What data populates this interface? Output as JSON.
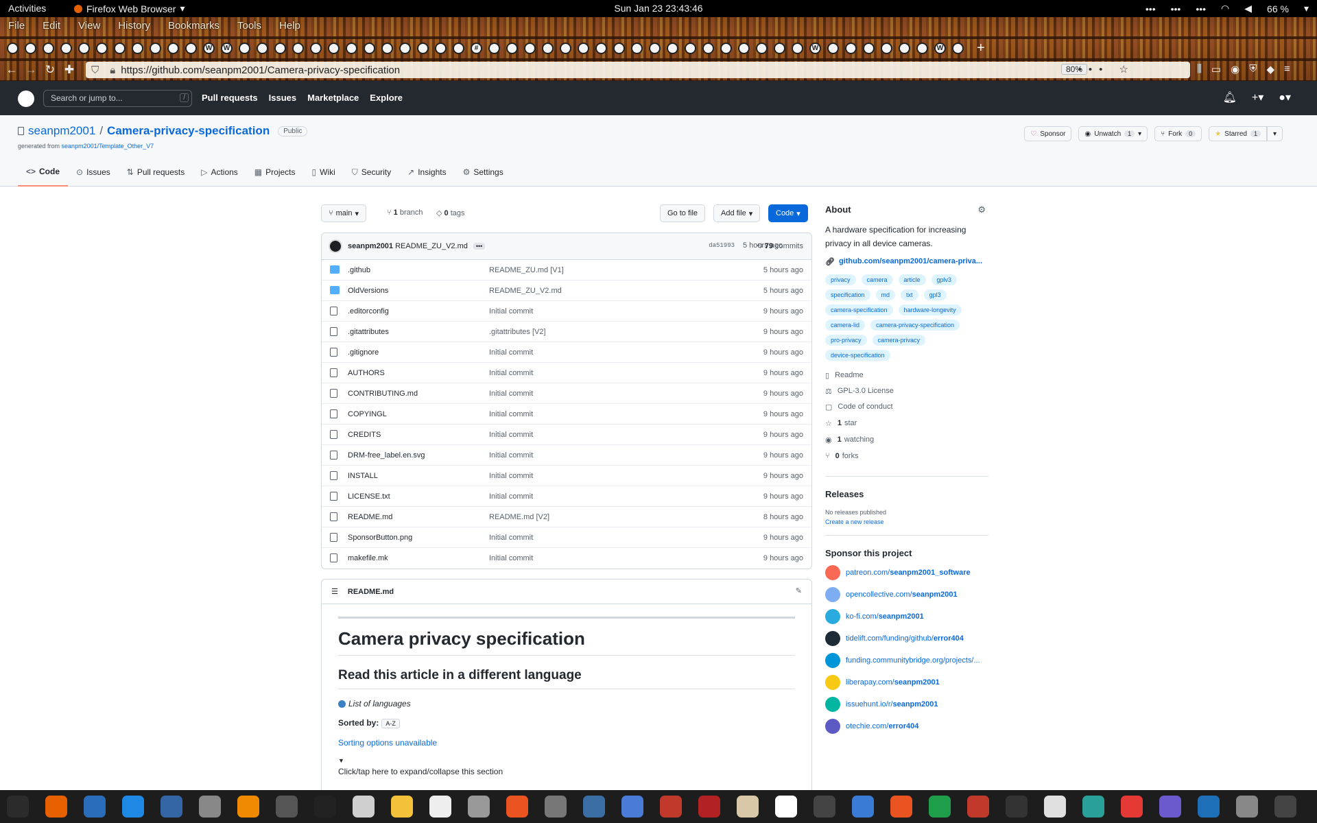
{
  "system": {
    "activities": "Activities",
    "app_name": "Firefox Web Browser",
    "clock": "Sun Jan 23  23:43:46",
    "battery": "66 %"
  },
  "browser": {
    "menu": [
      "File",
      "Edit",
      "View",
      "History",
      "Bookmarks",
      "Tools",
      "Help"
    ],
    "url": "https://github.com/seanpm2001/Camera-privacy-specification",
    "zoom": "80%"
  },
  "github": {
    "search_placeholder": "Search or jump to...",
    "search_shortcut": "/",
    "nav": [
      "Pull requests",
      "Issues",
      "Marketplace",
      "Explore"
    ]
  },
  "repo": {
    "owner": "seanpm2001",
    "sep": "/",
    "name": "Camera-privacy-specification",
    "visibility": "Public",
    "generated_prefix": "generated from ",
    "generated_from": "seanpm2001/Template_Other_V7",
    "actions": {
      "sponsor": "Sponsor",
      "unwatch": "Unwatch",
      "unwatch_count": "1",
      "fork": "Fork",
      "fork_count": "0",
      "starred": "Starred",
      "star_count": "1"
    },
    "tabs": [
      "Code",
      "Issues",
      "Pull requests",
      "Actions",
      "Projects",
      "Wiki",
      "Security",
      "Insights",
      "Settings"
    ]
  },
  "files": {
    "branch": "main",
    "branch_count": "1",
    "branch_label": "branch",
    "tag_count": "0",
    "tag_label": "tags",
    "go_to_file": "Go to file",
    "add_file": "Add file",
    "code": "Code",
    "commit": {
      "author": "seanpm2001",
      "message": "README_ZU_V2.md",
      "hash": "da51993",
      "age": "5 hours ago",
      "count": "79",
      "count_label": "commits"
    },
    "rows": [
      {
        "name": ".github",
        "msg": "README_ZU.md [V1]",
        "age": "5 hours ago",
        "type": "dir"
      },
      {
        "name": "OldVersions",
        "msg": "README_ZU_V2.md",
        "age": "5 hours ago",
        "type": "dir"
      },
      {
        "name": ".editorconfig",
        "msg": "Initial commit",
        "age": "9 hours ago",
        "type": "file"
      },
      {
        "name": ".gitattributes",
        "msg": ".gitattributes [V2]",
        "age": "9 hours ago",
        "type": "file"
      },
      {
        "name": ".gitignore",
        "msg": "Initial commit",
        "age": "9 hours ago",
        "type": "file"
      },
      {
        "name": "AUTHORS",
        "msg": "Initial commit",
        "age": "9 hours ago",
        "type": "file"
      },
      {
        "name": "CONTRIBUTING.md",
        "msg": "Initial commit",
        "age": "9 hours ago",
        "type": "file"
      },
      {
        "name": "COPYINGL",
        "msg": "Initial commit",
        "age": "9 hours ago",
        "type": "file"
      },
      {
        "name": "CREDITS",
        "msg": "Initial commit",
        "age": "9 hours ago",
        "type": "file"
      },
      {
        "name": "DRM-free_label.en.svg",
        "msg": "Initial commit",
        "age": "9 hours ago",
        "type": "file"
      },
      {
        "name": "INSTALL",
        "msg": "Initial commit",
        "age": "9 hours ago",
        "type": "file"
      },
      {
        "name": "LICENSE.txt",
        "msg": "Initial commit",
        "age": "9 hours ago",
        "type": "file"
      },
      {
        "name": "README.md",
        "msg": "README.md [V2]",
        "age": "8 hours ago",
        "type": "file"
      },
      {
        "name": "SponsorButton.png",
        "msg": "Initial commit",
        "age": "9 hours ago",
        "type": "file"
      },
      {
        "name": "makefile.mk",
        "msg": "Initial commit",
        "age": "9 hours ago",
        "type": "file"
      }
    ]
  },
  "readme": {
    "filename": "README.md",
    "h1": "Camera privacy specification",
    "h2": "Read this article in a different language",
    "languages": "List of languages",
    "sorted_by": "Sorted by:",
    "sort_key": "A-Z",
    "sort_link": "Sorting options unavailable",
    "triangle": "▼",
    "click_text": "Click/tap here to expand/collapse this section"
  },
  "about": {
    "title": "About",
    "description": "A hardware specification for increasing privacy in all device cameras.",
    "website": "github.com/seanpm2001/camera-priva...",
    "topics": [
      "privacy",
      "camera",
      "article",
      "gplv3",
      "specification",
      "md",
      "txt",
      "gpl3",
      "camera-specification",
      "hardware-longevity",
      "camera-lid",
      "camera-privacy-specification",
      "pro-privacy",
      "camera-privacy",
      "device-specification"
    ],
    "readme": "Readme",
    "license": "GPL-3.0 License",
    "conduct": "Code of conduct",
    "stars_n": "1",
    "stars": "star",
    "watching_n": "1",
    "watching": "watching",
    "forks_n": "0",
    "forks": "forks"
  },
  "releases": {
    "title": "Releases",
    "none": "No releases published",
    "create": "Create a new release"
  },
  "sponsor": {
    "title": "Sponsor this project",
    "links": [
      {
        "pre": "patreon.com/",
        "bold": "seanpm2001_software",
        "color": "#f96854"
      },
      {
        "pre": "opencollective.com/",
        "bold": "seanpm2001",
        "color": "#7fadf2"
      },
      {
        "pre": "ko-fi.com/",
        "bold": "seanpm2001",
        "color": "#29abe0"
      },
      {
        "pre": "tidelift.com/funding/github/",
        "bold": "error404",
        "color": "#1d2b36"
      },
      {
        "pre": "funding.communitybridge.org/projects/...",
        "bold": "",
        "color": "#0094d9"
      },
      {
        "pre": "liberapay.com/",
        "bold": "seanpm2001",
        "color": "#f6c915"
      },
      {
        "pre": "issuehunt.io/r/",
        "bold": "seanpm2001",
        "color": "#00b6a0"
      },
      {
        "pre": "otechie.com/",
        "bold": "error404",
        "color": "#5d59c5"
      }
    ]
  },
  "colors": {
    "accent": "#0969da",
    "header": "#24292f",
    "green": "#2da44e",
    "tab_underline": "#fd8c73"
  }
}
